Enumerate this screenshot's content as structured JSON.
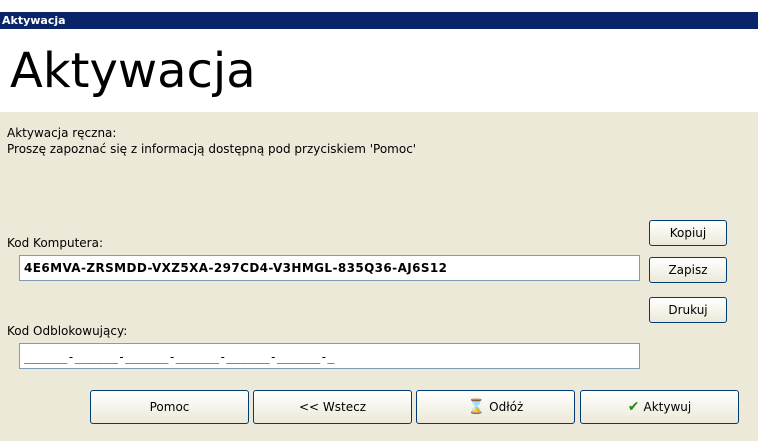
{
  "window": {
    "title": "Aktywacja"
  },
  "header": {
    "title": "Aktywacja"
  },
  "info": {
    "line1": "Aktywacja ręczna:",
    "line2": "Proszę zapoznać się z informacją dostępną pod przyciskiem 'Pomoc'"
  },
  "computer_code": {
    "label": "Kod Komputera:",
    "value": "4E6MVA-ZRSMDD-VXZ5XA-297CD4-V3HMGL-835Q36-AJ6S12"
  },
  "unlock_code": {
    "label": "Kod Odblokowujący:",
    "mask": "______-______-______-______-______-______-_"
  },
  "side_buttons": {
    "copy": "Kopiuj",
    "save": "Zapisz",
    "print": "Drukuj"
  },
  "bottom_buttons": {
    "help": "Pomoc",
    "back": "<< Wstecz",
    "postpone": "Odłóż",
    "activate": "Aktywuj"
  },
  "icons": {
    "postpone": "hourglass-icon",
    "activate": "checkmark-icon"
  }
}
